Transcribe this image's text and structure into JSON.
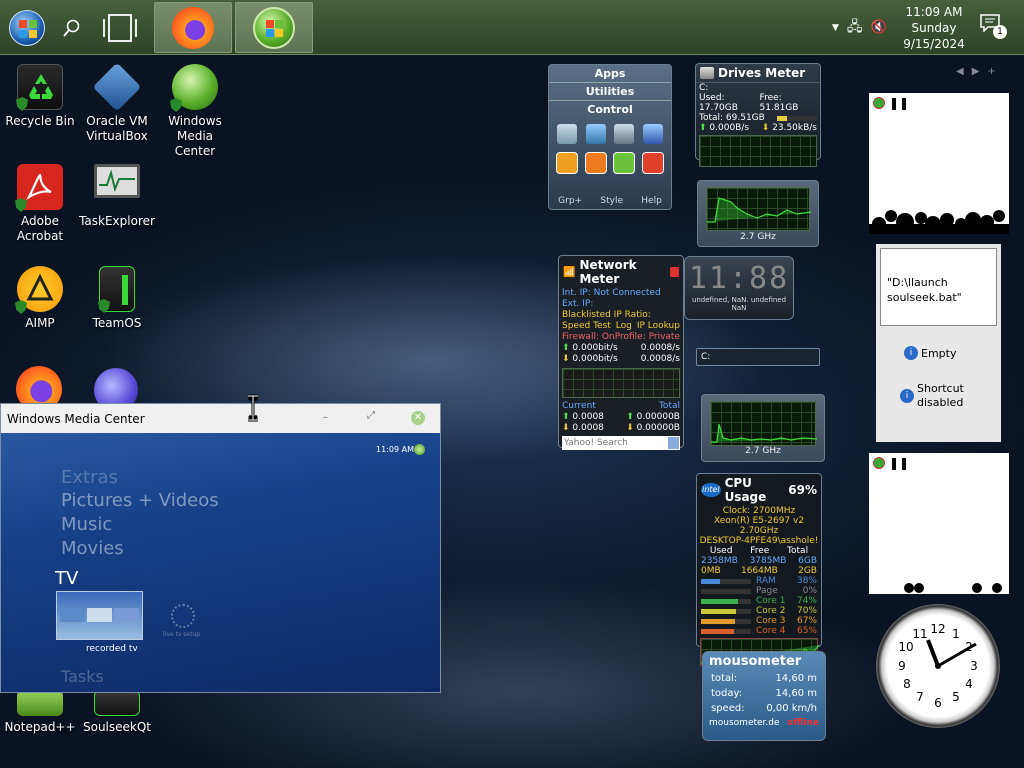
{
  "taskbar": {
    "clock": {
      "time": "11:09 AM",
      "day": "Sunday",
      "date": "9/15/2024"
    },
    "notification_count": "1"
  },
  "desktop_icons": [
    {
      "label": "Recycle Bin",
      "icon": "recycle-bin-icon"
    },
    {
      "label": "Oracle VM\nVirtualBox",
      "icon": "virtualbox-icon"
    },
    {
      "label": "Windows\nMedia Center",
      "icon": "media-center-icon"
    },
    {
      "label": "Adobe\nAcrobat",
      "icon": "acrobat-icon"
    },
    {
      "label": "TaskExplorer",
      "icon": "task-explorer-icon"
    },
    {
      "label": "AIMP",
      "icon": "aimp-icon"
    },
    {
      "label": "TeamOS",
      "icon": "teamos-icon"
    },
    {
      "label": "Notepad++",
      "icon": "notepadpp-icon"
    },
    {
      "label": "SoulseekQt",
      "icon": "soulseek-icon"
    }
  ],
  "launcher": {
    "tabs": [
      "Apps",
      "Utilities",
      "Control"
    ],
    "footer": [
      "Grp+",
      "Style",
      "Help"
    ]
  },
  "drives_meter": {
    "title": "Drives Meter",
    "drive": "C:",
    "used": "Used: 17.70GB",
    "free": "Free: 51.81GB",
    "total": "Total: 69.51GB",
    "up": "0.000B/s",
    "down": "23.50kB/s",
    "usage_fraction": 0.25
  },
  "cpu_graph_1": {
    "label": "2.7 GHz"
  },
  "cpu_graph_2": {
    "label": "2.7 GHz"
  },
  "network_meter": {
    "title": "Network Meter",
    "int_ip": "Int. IP: Not Connected",
    "ext_ip": "Ext. IP:",
    "blacklisted": "Blacklisted IP Ratio:",
    "speed_test": "Speed Test",
    "log": "Log",
    "ip_lookup": "IP Lookup",
    "firewall": "Firewall: On",
    "profile": "Profile: Private",
    "up1": "0.000bit/s",
    "up2": "0.0008/s",
    "down1": "0.000bit/s",
    "down2": "0.0008/s",
    "current": "Current",
    "total": "Total",
    "cur_up": "0.0008",
    "tot_up": "0.00000B",
    "cur_down": "0.0008",
    "tot_down": "0.00000B",
    "search_placeholder": "Yahoo! Search"
  },
  "digital_clock": {
    "time": "11:88",
    "caption": "undefined, NaN. undefined NaN"
  },
  "drive_input": {
    "value": "C:"
  },
  "cpu_usage": {
    "title": "CPU Usage",
    "percent": "69%",
    "clock": "Clock: 2700MHz",
    "cpu": "Xeon(R) E5-2697 v2 2.70GHz",
    "host": "DESKTOP-4PFE49\\asshole!",
    "headers": [
      "Used",
      "Free",
      "Total"
    ],
    "mem_row1": [
      "2358MB",
      "3785MB",
      "6GB"
    ],
    "mem_row2": [
      "0MB",
      "1664MB",
      "2GB"
    ],
    "rows": [
      {
        "label": "RAM",
        "value": "38%",
        "fill": 0.38,
        "color": "#4a8ad8"
      },
      {
        "label": "Page",
        "value": "0%",
        "fill": 0.0,
        "color": "#8a8a8a"
      },
      {
        "label": "Core 1",
        "value": "74%",
        "fill": 0.74,
        "color": "#3ab04a"
      },
      {
        "label": "Core 2",
        "value": "70%",
        "fill": 0.7,
        "color": "#c8c83a"
      },
      {
        "label": "Core 3",
        "value": "67%",
        "fill": 0.67,
        "color": "#e09a2a"
      },
      {
        "label": "Core 4",
        "value": "65%",
        "fill": 0.65,
        "color": "#d8602a"
      }
    ]
  },
  "mousometer": {
    "title": "mousometer",
    "total_label": "total:",
    "total": "14,60 m",
    "today_label": "today:",
    "today": "14,60 m",
    "speed_label": "speed:",
    "speed": "0,00 km/h",
    "site": "mousometer.de",
    "status": "offline"
  },
  "sticky_note": {
    "text": "\"D:\\llaunch soulseek.bat\"",
    "empty": "Empty",
    "shortcut": "Shortcut disabled"
  },
  "wmc": {
    "title": "Windows Media Center",
    "time": "11:09 AM",
    "menu": [
      "Extras",
      "Pictures + Videos",
      "Music",
      "Movies"
    ],
    "active": "TV",
    "tile_label": "recorded tv",
    "tile2_label": "live tv setup",
    "next": "Tasks"
  }
}
